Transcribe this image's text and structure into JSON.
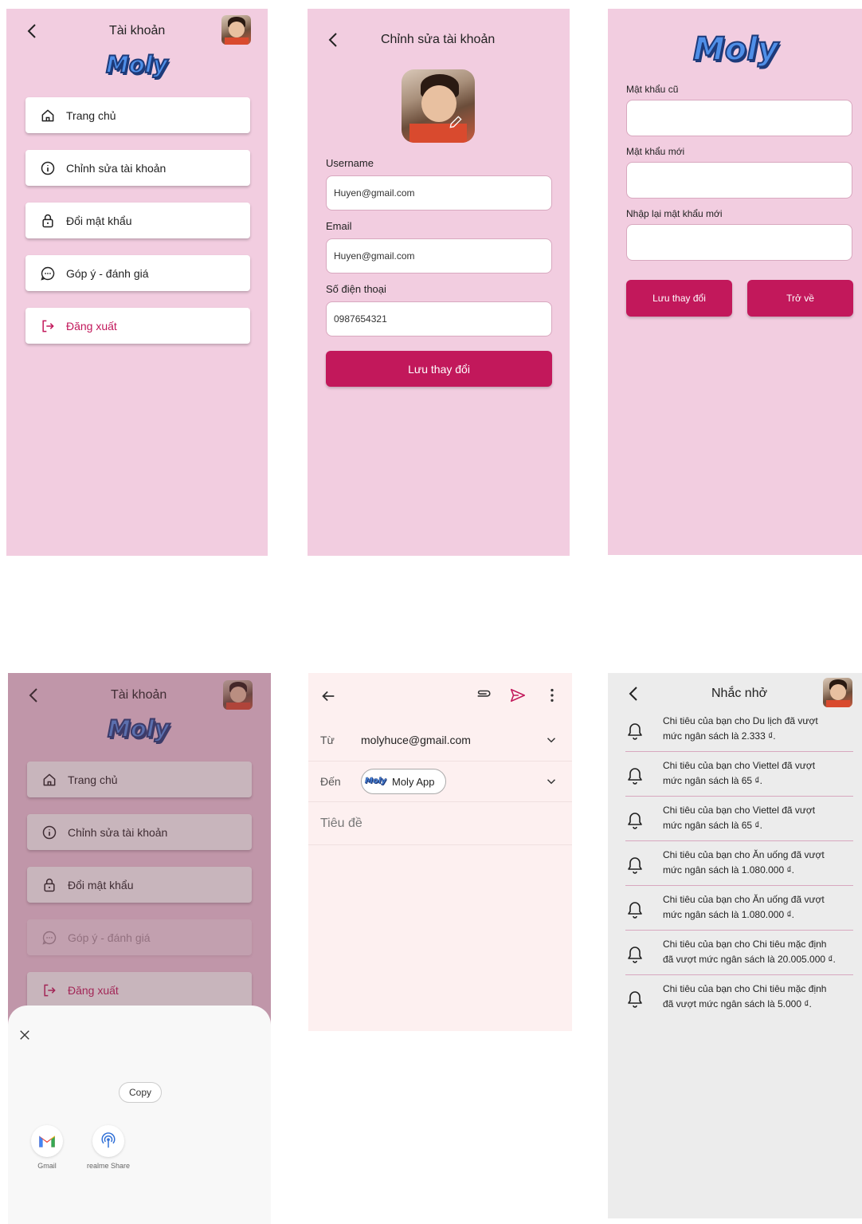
{
  "account_screen": {
    "title": "Tài khoản",
    "logo": "Moly",
    "menu": [
      {
        "label": "Trang chủ",
        "icon": "home-icon"
      },
      {
        "label": "Chỉnh sửa tài khoản",
        "icon": "info-icon"
      },
      {
        "label": "Đổi mật khẩu",
        "icon": "lock-icon"
      },
      {
        "label": "Góp ý - đánh giá",
        "icon": "chat-icon"
      },
      {
        "label": "Đăng xuất",
        "icon": "logout-icon"
      }
    ]
  },
  "edit_screen": {
    "title": "Chỉnh sửa tài khoản",
    "username_label": "Username",
    "username_value": "Huyen@gmail.com",
    "email_label": "Email",
    "email_value": "Huyen@gmail.com",
    "phone_label": "Số điện thoại",
    "phone_value": "0987654321",
    "save_label": "Lưu thay đổi"
  },
  "password_screen": {
    "logo": "Moly",
    "old_label": "Mật khẩu cũ",
    "new_label": "Mật khẩu mới",
    "confirm_label": "Nhập lại mật khẩu mới",
    "save_label": "Lưu thay đổi",
    "back_label": "Trở về"
  },
  "share_screen": {
    "title": "Tài khoản",
    "logo": "Moly",
    "menu": [
      {
        "label": "Trang chủ"
      },
      {
        "label": "Chỉnh sửa tài khoản"
      },
      {
        "label": "Đổi mật khẩu"
      },
      {
        "label": "Góp ý - đánh giá"
      },
      {
        "label": "Đăng xuất"
      }
    ],
    "copy_label": "Copy",
    "apps": [
      {
        "label": "Gmail"
      },
      {
        "label": "realme Share"
      }
    ]
  },
  "mail_screen": {
    "from_label": "Từ",
    "from_value": "molyhuce@gmail.com",
    "to_label": "Đến",
    "to_chip_logo": "Moly",
    "to_chip": "Moly App",
    "subject_placeholder": "Tiêu đề"
  },
  "reminder_screen": {
    "title": "Nhắc nhở",
    "items": [
      {
        "line1": "Chi tiêu của bạn cho Du lịch đã vượt",
        "line2": "mức ngân sách là 2.333 ₫."
      },
      {
        "line1": "Chi tiêu của bạn cho Viettel  đã vượt",
        "line2": "mức ngân sách là 65 ₫."
      },
      {
        "line1": "Chi tiêu của bạn cho Viettel  đã vượt",
        "line2": "mức ngân sách là 65 ₫."
      },
      {
        "line1": "Chi tiêu của bạn cho Ăn uống đã vượt",
        "line2": "mức ngân sách là 1.080.000 ₫."
      },
      {
        "line1": "Chi tiêu của bạn cho Ăn uống đã vượt",
        "line2": "mức ngân sách là 1.080.000 ₫."
      },
      {
        "line1": "Chi tiêu của bạn cho Chi tiêu mặc định",
        "line2": "đã vượt mức ngân sách là 20.005.000 ₫."
      },
      {
        "line1": "Chi tiêu của bạn cho Chi tiêu mặc định",
        "line2": "đã vượt mức ngân sách là 5.000 ₫."
      }
    ]
  },
  "colors": {
    "pink_bg": "#f2cde0",
    "accent": "#c2185b",
    "logo_blue": "#4f8fe8"
  }
}
